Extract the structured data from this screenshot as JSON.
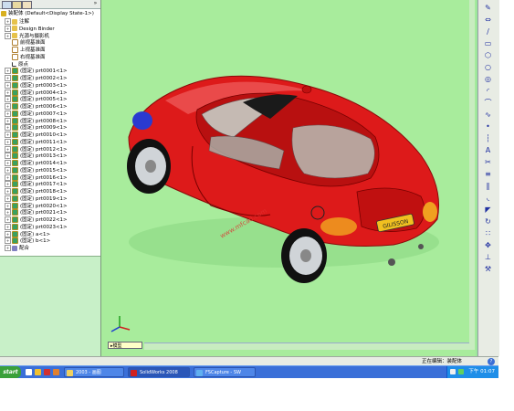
{
  "tree": {
    "root_label": "装配体 (Default<Display State-1>)",
    "items": [
      {
        "label": "注解",
        "icon": "folder",
        "expand": true
      },
      {
        "label": "Design Binder",
        "icon": "folder",
        "expand": true
      },
      {
        "label": "光源与摄影机",
        "icon": "folder",
        "expand": true
      },
      {
        "label": "前视基准面",
        "icon": "plane",
        "expand": false
      },
      {
        "label": "上视基准面",
        "icon": "plane",
        "expand": false
      },
      {
        "label": "右视基准面",
        "icon": "plane",
        "expand": false
      },
      {
        "label": "原点",
        "icon": "origin",
        "expand": false
      },
      {
        "label": "(固定) prt0001<1>",
        "icon": "part",
        "expand": true
      },
      {
        "label": "(固定) prt0002<1>",
        "icon": "part",
        "expand": true
      },
      {
        "label": "(固定) prt0003<1>",
        "icon": "part",
        "expand": true
      },
      {
        "label": "(固定) prt0004<1>",
        "icon": "part",
        "expand": true
      },
      {
        "label": "(固定) prt0005<1>",
        "icon": "part",
        "expand": true
      },
      {
        "label": "(固定) prt0006<1>",
        "icon": "part",
        "expand": true
      },
      {
        "label": "(固定) prt0007<1>",
        "icon": "part",
        "expand": true
      },
      {
        "label": "(固定) prt0008<1>",
        "icon": "part",
        "expand": true
      },
      {
        "label": "(固定) prt0009<1>",
        "icon": "part",
        "expand": true
      },
      {
        "label": "(固定) prt0010<1>",
        "icon": "part",
        "expand": true
      },
      {
        "label": "(固定) prt0011<1>",
        "icon": "part",
        "expand": true
      },
      {
        "label": "(固定) prt0012<1>",
        "icon": "part",
        "expand": true
      },
      {
        "label": "(固定) prt0013<1>",
        "icon": "part",
        "expand": true
      },
      {
        "label": "(固定) prt0014<1>",
        "icon": "part",
        "expand": true
      },
      {
        "label": "(固定) prt0015<1>",
        "icon": "part",
        "expand": true
      },
      {
        "label": "(固定) prt0016<1>",
        "icon": "part",
        "expand": true
      },
      {
        "label": "(固定) prt0017<1>",
        "icon": "part",
        "expand": true
      },
      {
        "label": "(固定) prt0018<1>",
        "icon": "part",
        "expand": true
      },
      {
        "label": "(固定) prt0019<1>",
        "icon": "part",
        "expand": true
      },
      {
        "label": "(固定) prt0020<1>",
        "icon": "part",
        "expand": true
      },
      {
        "label": "(固定) prt0021<1>",
        "icon": "part",
        "expand": true
      },
      {
        "label": "(固定) prt0022<1>",
        "icon": "part",
        "expand": true
      },
      {
        "label": "(固定) prt0023<1>",
        "icon": "part",
        "expand": true
      },
      {
        "label": "(固定) a<1>",
        "icon": "part",
        "expand": true
      },
      {
        "label": "(固定) b<1>",
        "icon": "part",
        "expand": true
      },
      {
        "label": "配合",
        "icon": "mate",
        "expand": true
      }
    ]
  },
  "viewport": {
    "config_tab": "▸模型",
    "watermark": "www.mfcad.com",
    "plate_text": "GILISSON",
    "colors": {
      "background": "#a8ec9c",
      "body": "#dd1a1a",
      "accent": "#f0a020"
    }
  },
  "right_toolbar": [
    "sketch-icon",
    "smart-dimension-icon",
    "line-icon",
    "rectangle-icon",
    "polygon-icon",
    "circle-icon",
    "circle-perimeter-icon",
    "arc-icon",
    "tangent-arc-icon",
    "spline-icon",
    "point-icon",
    "centerline-icon",
    "text-icon",
    "trim-icon",
    "offset-icon",
    "mirror-icon",
    "fillet-icon",
    "chamfer-icon",
    "convert-icon",
    "linear-pattern-icon",
    "move-icon",
    "relation-icon",
    "repair-icon"
  ],
  "status": {
    "text": "正在编辑：装配体"
  },
  "taskbar": {
    "start": "start",
    "tasks": [
      {
        "label": "2003 - 画图",
        "icon": "folder-icon"
      },
      {
        "label": "SolidWorks 2008",
        "icon": "solidworks-icon"
      },
      {
        "label": "FSCapture - SW",
        "icon": "capture-icon"
      }
    ],
    "clock": "下午 01:07"
  }
}
